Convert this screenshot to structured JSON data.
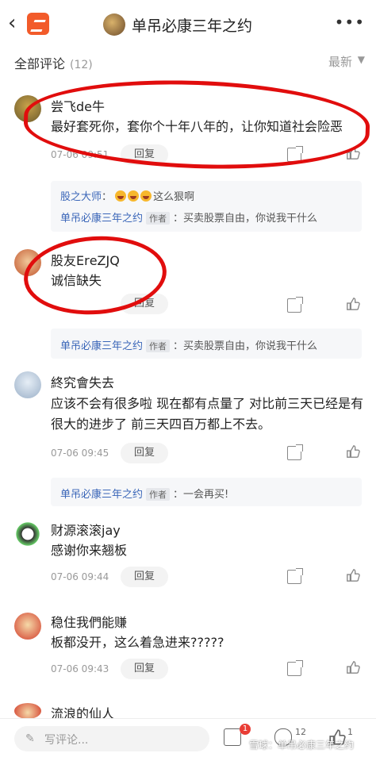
{
  "header": {
    "title": "单吊必康三年之约",
    "back_icon": "chevron-left-icon",
    "more_icon": "more-dots-icon"
  },
  "section": {
    "label": "全部评论",
    "count": "(12)",
    "sort_label": "最新"
  },
  "comments": [
    {
      "name": "尝飞de牛",
      "text": "最好套死你，套你个十年八年的，让你知道社会险恶",
      "time": "07-06 09:51",
      "reply": "回复"
    },
    {
      "name": "股友ErеZJQ",
      "text": "诚信缺失",
      "time": "",
      "reply": "回复"
    },
    {
      "name": "終究會失去",
      "text": "应该不会有很多啦  现在都有点量了 对比前三天已经是有很大的进步了  前三天四百万都上不去。",
      "time": "07-06 09:45",
      "reply": "回复"
    },
    {
      "name": "财源滚滚jay",
      "text": "感谢你来翘板",
      "time": "07-06 09:44",
      "reply": "回复"
    },
    {
      "name": "稳住我們能赚",
      "text": "板都没开，这么着急进来?????",
      "time": "07-06 09:43",
      "reply": "回复"
    },
    {
      "name": "流浪的仙人",
      "text": "",
      "time": "",
      "reply": ""
    }
  ],
  "subreplies": {
    "r1_name": "股之大师",
    "r1_text": "这么狠啊",
    "r2_name": "单吊必康三年之约",
    "r2_tag": "作者",
    "r2_text": "：买卖股票自由，你说我干什么",
    "r3_name": "单吊必康三年之约",
    "r3_tag": "作者",
    "r3_text": "：买卖股票自由，你说我干什么",
    "r4_name": "单吊必康三年之约",
    "r4_tag": "作者",
    "r4_text": "：一会再买!"
  },
  "bottombar": {
    "write_placeholder": "写评论...",
    "comment_badge": "1",
    "comment_count": "12",
    "like_count": "1"
  },
  "watermark": "雪球：单吊必康三年之约",
  "colors": {
    "accent": "#f25b2a",
    "link": "#3a66b8",
    "annotation": "#e10d0d"
  }
}
